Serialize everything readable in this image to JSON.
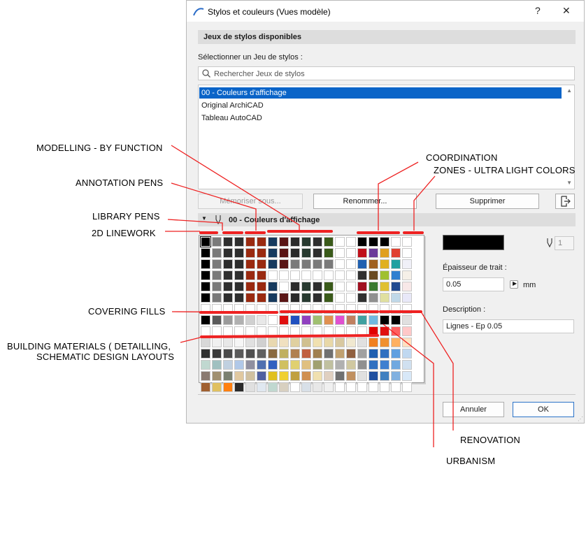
{
  "dialog": {
    "title": "Stylos et couleurs (Vues modèle)",
    "help_label": "?",
    "close_label": "✕",
    "section_title": "Jeux de stylos disponibles",
    "select_label": "Sélectionner un Jeu de stylos :",
    "search_placeholder": "Rechercher Jeux de stylos",
    "pen_sets": [
      {
        "label": "00 - Couleurs d'affichage",
        "selected": true
      },
      {
        "label": "Original ArchiCAD",
        "selected": false
      },
      {
        "label": "Tableau AutoCAD",
        "selected": false
      }
    ],
    "buttons": {
      "memorize": "Mémoriser sous...",
      "rename": "Renommer...",
      "delete": "Supprimer",
      "cancel": "Annuler",
      "ok": "OK"
    },
    "set_header": "00 - Couleurs d'affichage",
    "pen_number": "1",
    "thickness_label": "Épaisseur de trait :",
    "thickness_value": "0.05",
    "thickness_unit": "mm",
    "description_label": "Description :",
    "description_value": "Lignes - Ep 0.05",
    "selected_pen_color": "#000000"
  },
  "annotations": {
    "modelling": "MODELLING - BY FUNCTION",
    "annotation_pens": "ANNOTATION PENS",
    "library_pens": "LIBRARY PENS",
    "linework_2d": "2D LINEWORK",
    "covering_fills": "COVERING FILLS",
    "building_materials_1": "BUILDING MATERIALS ( DETAILLING,",
    "building_materials_2": "SCHEMATIC DESIGN LAYOUTS",
    "coordination": "COORDINATION",
    "zones": "ZONES - ULTRA LIGHT COLORS",
    "renovation": "RENOVATION",
    "urbanism": "URBANISM"
  },
  "palette": {
    "rows": [
      [
        "#000000",
        "#7a7a7a",
        "#2e2e2e",
        "#2e2e2e",
        "#9a2a10",
        "#9a2a10",
        "#173a5e",
        "#5a1515",
        "#2a2a2a",
        "#283a30",
        "#2e2e2e",
        "#3a5a1a",
        "#ffffff",
        "#ffffff",
        "#000000",
        "#000000",
        "#000000",
        "#ffffff",
        "#ffffff"
      ],
      [
        "#000000",
        "#7a7a7a",
        "#2e2e2e",
        "#2e2e2e",
        "#9a2a10",
        "#9a2a10",
        "#173a5e",
        "#5a1515",
        "#2a2a2a",
        "#283a30",
        "#2e2e2e",
        "#3a5a1a",
        "#ffffff",
        "#ffffff",
        "#c0101a",
        "#6a3a9a",
        "#e0a020",
        "#e04030",
        "#ffffff"
      ],
      [
        "#000000",
        "#7a7a7a",
        "#2e2e2e",
        "#2e2e2e",
        "#9a2a10",
        "#9a2a10",
        "#173a5e",
        "#5a1515",
        "#7a7a7a",
        "#7a7a7a",
        "#7a7a7a",
        "#7a7a7a",
        "#ffffff",
        "#ffffff",
        "#2060b0",
        "#a06020",
        "#e0b020",
        "#20a0a0",
        "#f0f0f8"
      ],
      [
        "#000000",
        "#7a7a7a",
        "#2e2e2e",
        "#2e2e2e",
        "#9a2a10",
        "#9a2a10",
        "#ffffff",
        "#ffffff",
        "#ffffff",
        "#ffffff",
        "#ffffff",
        "#ffffff",
        "#ffffff",
        "#ffffff",
        "#303030",
        "#6a4a20",
        "#a0c030",
        "#3080d0",
        "#f6f0e8"
      ],
      [
        "#000000",
        "#7a7a7a",
        "#2e2e2e",
        "#2e2e2e",
        "#9a2a10",
        "#9a2a10",
        "#173a5e",
        "#ffffff",
        "#2a2a2a",
        "#283a30",
        "#2e2e2e",
        "#3a5a1a",
        "#ffffff",
        "#ffffff",
        "#a01020",
        "#3a7a30",
        "#e0c030",
        "#204a90",
        "#f8e8e8"
      ],
      [
        "#000000",
        "#7a7a7a",
        "#2e2e2e",
        "#2e2e2e",
        "#9a2a10",
        "#9a2a10",
        "#173a5e",
        "#5a1515",
        "#2a2a2a",
        "#283a30",
        "#2e2e2e",
        "#3a5a1a",
        "#ffffff",
        "#ffffff",
        "#303030",
        "#909090",
        "#e0e0a0",
        "#c0d8e8",
        "#e8e8f8"
      ],
      [
        "#ffffff",
        "#ffffff",
        "#ffffff",
        "#ffffff",
        "#ffffff",
        "#ffffff",
        "#ffffff",
        "#ffffff",
        "#ffffff",
        "#ffffff",
        "#ffffff",
        "#ffffff",
        "#ffffff",
        "#ffffff",
        "#ffffff",
        "#ffffff",
        "#ffffff",
        "#ffffff",
        "#ffffff"
      ],
      [
        "#000000",
        "#5a5a5a",
        "#9a9a9a",
        "#b0b0b0",
        "#d0d0d0",
        "#e8e8e8",
        "#ffffff",
        "#e01010",
        "#2050c0",
        "#9040c0",
        "#a0c070",
        "#e09050",
        "#e050d0",
        "#c08060",
        "#40a0a0",
        "#70b8e0",
        "#000000",
        "#000000",
        "#e0e0e0"
      ],
      [
        "#ffffff",
        "#ffffff",
        "#ffffff",
        "#ffffff",
        "#ffffff",
        "#ffffff",
        "#ffffff",
        "#ffffff",
        "#ffffff",
        "#ffffff",
        "#ffffff",
        "#ffffff",
        "#ffffff",
        "#ffffff",
        "#ffffff",
        "#e00000",
        "#e01010",
        "#ff6060",
        "#ffc8c8"
      ],
      [
        "#d8d8d8",
        "#f0f0f0",
        "#e8e8e8",
        "#f6f6f6",
        "#e0e0e0",
        "#d0d0d0",
        "#e8d8b0",
        "#f0e0c0",
        "#e0d0a0",
        "#d0c090",
        "#f0e0b0",
        "#e8d8a8",
        "#d8c8a0",
        "#f0e8d0",
        "#e0e0e0",
        "#f08020",
        "#f09030",
        "#ffb060",
        "#ffe0c0"
      ],
      [
        "#303030",
        "#3a3a3a",
        "#4a4a4a",
        "#5a5a5a",
        "#505050",
        "#606060",
        "#8a6a40",
        "#c0b060",
        "#b08050",
        "#c06040",
        "#a08050",
        "#707070",
        "#c0a070",
        "#906040",
        "#a0a0a0",
        "#2060b0",
        "#3070c0",
        "#60a0e0",
        "#c0d8f0"
      ],
      [
        "#c0d8d0",
        "#a0c0c0",
        "#c0d0e0",
        "#b0c8e8",
        "#9090a0",
        "#5070b0",
        "#3060c0",
        "#d0c060",
        "#e0d070",
        "#e0c080",
        "#a0a070",
        "#c0c0a0",
        "#b0b0b0",
        "#d0c8a0",
        "#909090",
        "#3070c0",
        "#4080d0",
        "#70a8e0",
        "#d0e0f0"
      ],
      [
        "#8a7a70",
        "#a09070",
        "#7a8070",
        "#e0c8a0",
        "#d0c0a0",
        "#5060a0",
        "#e0c020",
        "#f0d030",
        "#c0a040",
        "#d09050",
        "#f0e0b0",
        "#e0d0c0",
        "#707070",
        "#c09060",
        "#e0e0e0",
        "#2050a0",
        "#4080c0",
        "#80b0e0",
        "#d8e8f8"
      ],
      [
        "#a06030",
        "#e0c060",
        "#ff8010",
        "#2a2a2a",
        "#e0e0e0",
        "#e0e8f0",
        "#c0d8d0",
        "#d8d0c0",
        "#ffffff",
        "#d8e0e8",
        "#e8e8e8",
        "#f0f0f0",
        "#ffffff",
        "#ffffff",
        "#ffffff",
        "#ffffff",
        "#ffffff",
        "#ffffff",
        "#ffffff"
      ]
    ]
  }
}
